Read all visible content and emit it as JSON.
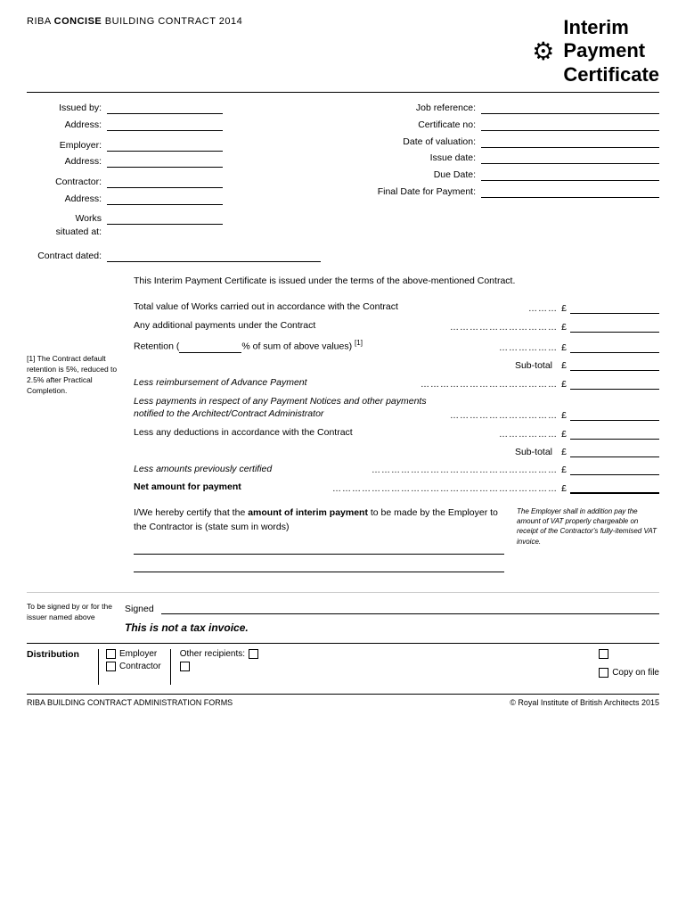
{
  "header": {
    "left_text_prefix": "RIBA ",
    "left_text_concise": "CONCISE",
    "left_text_suffix": " BUILDING CONTRACT 2014",
    "title_line1": "Interim",
    "title_line2": "Payment",
    "title_line3": "Certificate"
  },
  "left_fields": {
    "issued_by_label": "Issued by:",
    "address1_label": "Address:",
    "employer_label": "Employer:",
    "address2_label": "Address:",
    "contractor_label": "Contractor:",
    "address3_label": "Address:",
    "works_label": "Works",
    "situated_label": "situated at:"
  },
  "right_fields": {
    "job_ref_label": "Job reference:",
    "cert_no_label": "Certificate no:",
    "valuation_date_label": "Date of valuation:",
    "issue_date_label": "Issue date:",
    "due_date_label": "Due Date:",
    "final_date_label": "Final Date for Payment:"
  },
  "contract_dated": {
    "label": "Contract dated:"
  },
  "intro": {
    "text": "This Interim Payment Certificate is issued under the terms of the above-mentioned Contract."
  },
  "amounts": {
    "row1_desc": "Total value of Works carried out in accordance with the Contract",
    "row1_dots": "………",
    "row2_desc": "Any additional payments under the Contract",
    "row2_dots": "……………………………",
    "row3_desc": "Retention (              % of sum of above values)",
    "row3_ref": "[1]",
    "row3_dots": "………………",
    "subtotal1_label": "Sub-total",
    "row4_desc": "Less reimbursement of Advance Payment",
    "row4_dots": "……………………………………",
    "row5_desc": "Less payments in respect of any Payment Notices and other payments notified to the Architect/Contract Administrator",
    "row5_dots": "……………………………",
    "row6_desc": "Less any deductions in accordance with the Contract",
    "row6_dots": "………………",
    "subtotal2_label": "Sub-total",
    "row7_desc": "Less amounts previously certified",
    "row7_dots": "…………………………………………………",
    "net_desc": "Net amount for payment",
    "net_dots": "……………………………………………………………",
    "currency": "£",
    "footnote": "[1] The Contract default retention is 5%, reduced to 2.5% after Practical Completion."
  },
  "certify": {
    "text_prefix": "I/We hereby certify that the ",
    "text_bold": "amount of interim payment",
    "text_suffix": " to be made by the Employer to the Contractor is (state sum in words)",
    "note": "The Employer shall in addition pay the amount of VAT properly chargeable on receipt of the Contractor's fully-itemised VAT invoice."
  },
  "signed": {
    "note": "To be signed by or for the issuer named above",
    "label": "Signed",
    "not_tax": "This is not a tax invoice."
  },
  "distribution": {
    "label": "Distribution",
    "employer_label": "Employer",
    "contractor_label": "Contractor",
    "other_label": "Other recipients:",
    "copy_label": "Copy on file"
  },
  "footer": {
    "left": "RIBA BUILDING CONTRACT ADMINISTRATION FORMS",
    "right": "© Royal Institute of British Architects 2015"
  }
}
